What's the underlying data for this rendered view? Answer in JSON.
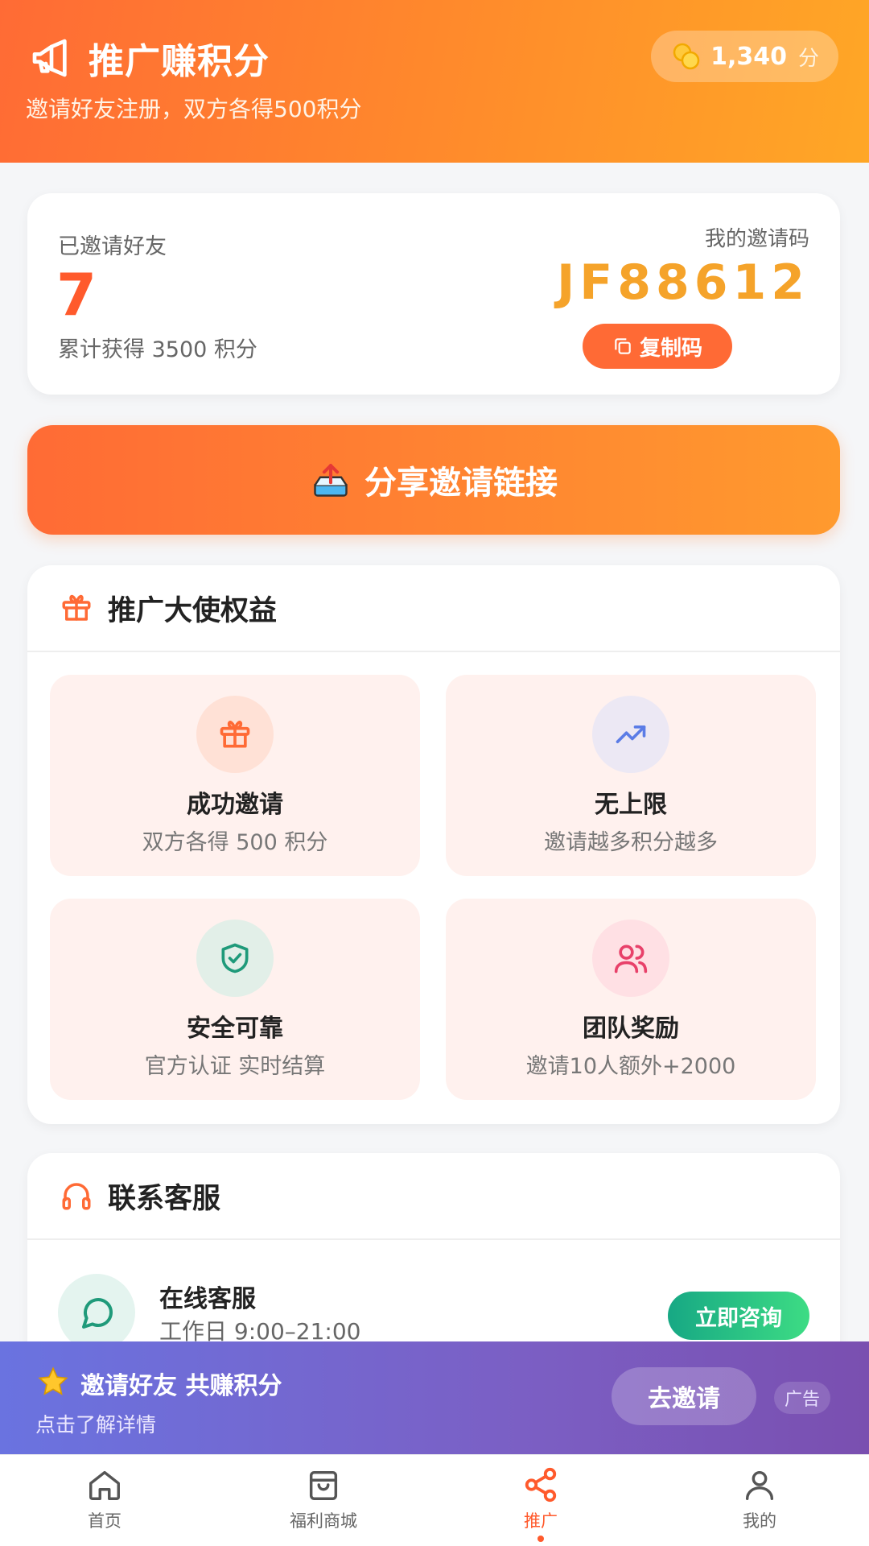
{
  "header": {
    "title": "推广赚积分",
    "subtitle": "邀请好友注册，双方各得500积分",
    "points_value": "1,340",
    "points_unit": "分"
  },
  "invite": {
    "invited_label": "已邀请好友",
    "invited_count": "7",
    "earned_text": "累计获得 3500 积分",
    "code_label": "我的邀请码",
    "code": "JF88612",
    "copy_label": "复制码"
  },
  "share": {
    "label": "分享邀请链接"
  },
  "benefits": {
    "title": "推广大使权益",
    "items": [
      {
        "title": "成功邀请",
        "desc": "双方各得 500 积分"
      },
      {
        "title": "无上限",
        "desc": "邀请越多积分越多"
      },
      {
        "title": "安全可靠",
        "desc": "官方认证 实时结算"
      },
      {
        "title": "团队奖励",
        "desc": "邀请10人额外+2000"
      }
    ]
  },
  "service": {
    "title": "联系客服",
    "name": "在线客服",
    "hours": "工作日 9:00–21:00",
    "button": "立即咨询"
  },
  "ad": {
    "title": "邀请好友 共赚积分",
    "subtitle": "点击了解详情",
    "button": "去邀请",
    "tag": "广告"
  },
  "tabbar": {
    "items": [
      {
        "label": "首页",
        "icon": "home-icon"
      },
      {
        "label": "福利商城",
        "icon": "shopping-bag-icon"
      },
      {
        "label": "推广",
        "icon": "share-icon"
      },
      {
        "label": "我的",
        "icon": "user-icon"
      }
    ],
    "active": "推广"
  },
  "colors": {
    "accent": "#ff5a2c",
    "code": "#f5a32a",
    "consult": "#17a884",
    "ad": "#6a73e0"
  }
}
